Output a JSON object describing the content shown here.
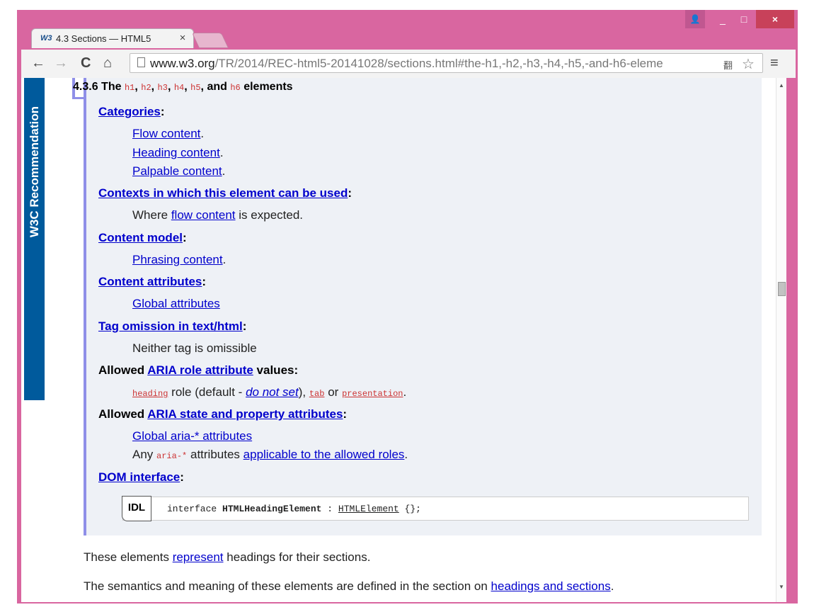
{
  "browser": {
    "tab_logo": "W3",
    "tab_title": "4.3 Sections — HTML5",
    "tab_close": "×",
    "url_host": "www.w3.org",
    "url_path": "/TR/2014/REC-html5-20141028/sections.html#the-h1,-h2,-h3,-h4,-h5,-and-h6-eleme",
    "icons": {
      "back": "←",
      "forward": "→",
      "reload": "C",
      "home": "⌂",
      "translate": "翻",
      "star": "☆",
      "menu": "≡",
      "user": "👤",
      "minimize": "_",
      "maximize": "□",
      "close": "×"
    }
  },
  "side_tag": "W3C Recommendation",
  "section": {
    "number": "4.3.6",
    "title_pre": "The",
    "codes": [
      "h1",
      "h2",
      "h3",
      "h4",
      "h5"
    ],
    "title_and": "and",
    "last_code": "h6",
    "title_post": "elements"
  },
  "definitions": {
    "categories": {
      "label": "Categories",
      "items": [
        "Flow content",
        "Heading content",
        "Palpable content"
      ]
    },
    "contexts": {
      "label": "Contexts in which this element can be used",
      "pre": "Where",
      "link": "flow content",
      "post": "is expected."
    },
    "content_model": {
      "label": "Content model",
      "items": [
        "Phrasing content"
      ]
    },
    "content_attributes": {
      "label": "Content attributes",
      "items": [
        "Global attributes"
      ]
    },
    "tag_omission": {
      "label": "Tag omission in text/html",
      "value": "Neither tag is omissible"
    },
    "aria_role": {
      "pre": "Allowed",
      "link": "ARIA role attribute",
      "post": "values:",
      "code1": "heading",
      "mid1": "role (default -",
      "italic_link": "do not set",
      "mid2": "),",
      "code2": "tab",
      "mid3": "or",
      "code3": "presentation"
    },
    "aria_state": {
      "pre": "Allowed",
      "link": "ARIA state and property attributes",
      "item1": "Global aria-* attributes",
      "any_pre": "Any",
      "any_code": "aria-*",
      "any_mid": "attributes",
      "any_link": "applicable to the allowed roles"
    },
    "dom_interface": {
      "label": "DOM interface"
    }
  },
  "idl": {
    "label": "IDL",
    "pre": "interface",
    "name": "HTMLHeadingElement",
    "sep": ":",
    "parent": "HTMLElement",
    "post": "{};"
  },
  "paragraphs": {
    "p1_pre": "These elements",
    "p1_link": "represent",
    "p1_post": "headings for their sections.",
    "p2_pre": "The semantics and meaning of these elements are defined in the section on",
    "p2_link": "headings and sections"
  },
  "colors": {
    "frame": "#d966a0",
    "side_tag": "#005a9c",
    "def_bar": "#8f8fe8",
    "def_bg": "#eef1f6",
    "link": "#0000cc",
    "code": "#cc3333"
  }
}
